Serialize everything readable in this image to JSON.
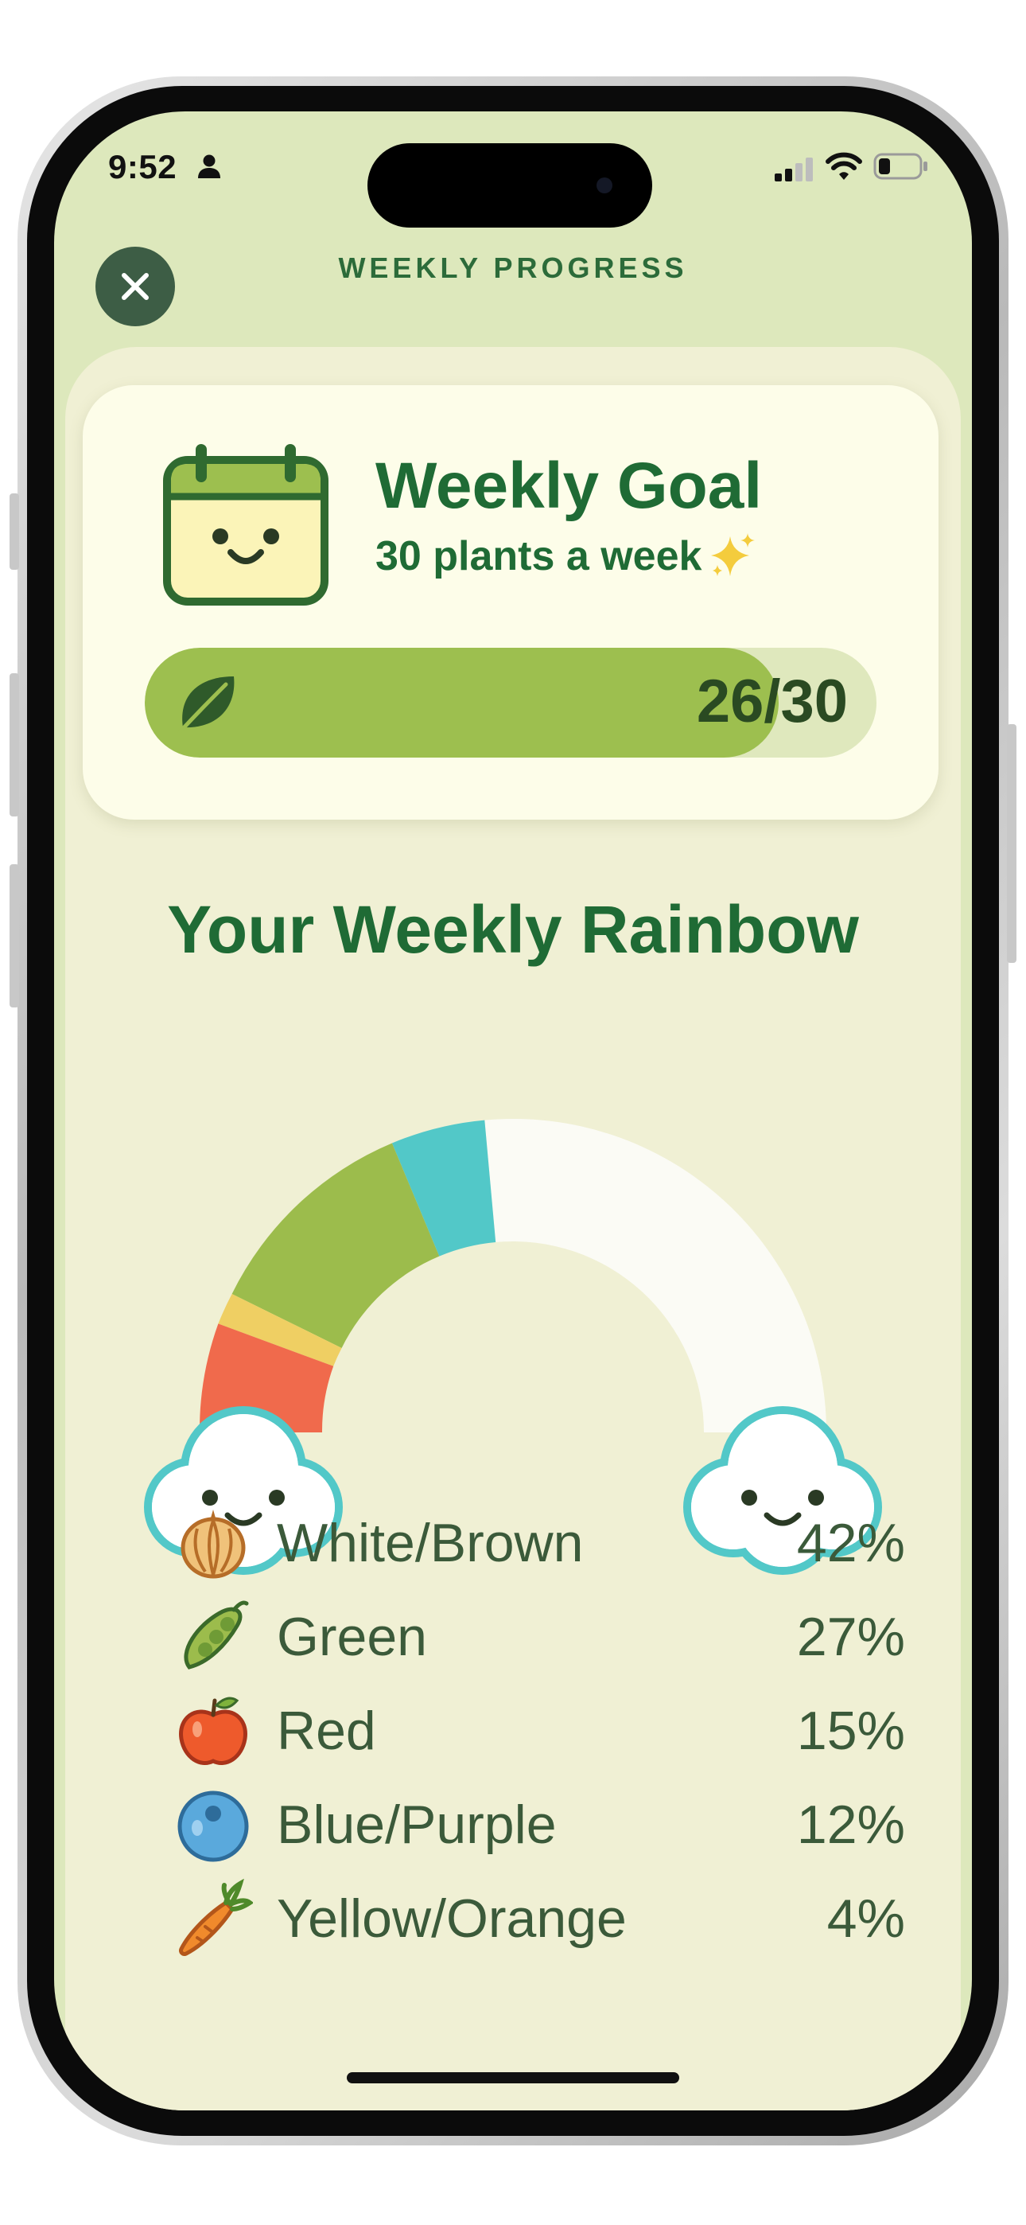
{
  "status_bar": {
    "time": "9:52"
  },
  "header": {
    "title": "WEEKLY PROGRESS",
    "close_icon": "close-icon"
  },
  "goal_card": {
    "title": "Weekly Goal",
    "subtitle": "30 plants a week",
    "progress": {
      "current": 26,
      "total": 30,
      "label": "26/30"
    },
    "icons": [
      "calendar-icon",
      "sparkle-icon",
      "leaf-icon"
    ]
  },
  "rainbow": {
    "title": "Your Weekly Rainbow",
    "colors": {
      "red": "#f06a4c",
      "yellow": "#efcf63",
      "green": "#9cbc4c",
      "blue": "#52c8c8",
      "white": "#fbfbf5"
    }
  },
  "legend": [
    {
      "label": "White/Brown",
      "value": "42%",
      "icon": "garlic-icon"
    },
    {
      "label": "Green",
      "value": "27%",
      "icon": "peapod-icon"
    },
    {
      "label": "Red",
      "value": "15%",
      "icon": "apple-icon"
    },
    {
      "label": "Blue/Purple",
      "value": "12%",
      "icon": "blueberry-icon"
    },
    {
      "label": "Yellow/Orange",
      "value": "4%",
      "icon": "carrot-icon"
    }
  ]
}
